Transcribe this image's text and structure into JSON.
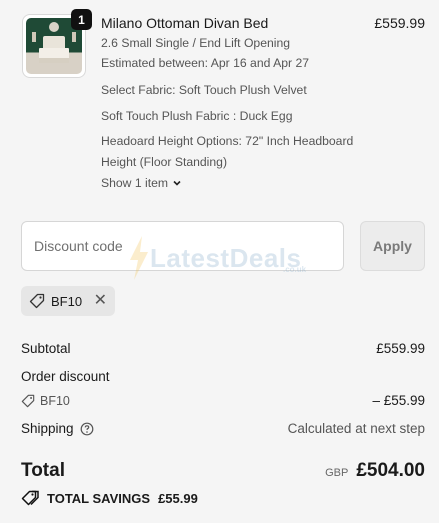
{
  "product": {
    "quantity": "1",
    "name": "Milano Ottoman Divan Bed",
    "price": "£559.99",
    "lines": [
      "2.6 Small Single / End Lift Opening",
      "Estimated between: Apr 16 and Apr 27",
      "Select Fabric: Soft Touch Plush Velvet",
      "Soft Touch Plush Fabric : Duck Egg",
      "Headoard Height Options: 72\" Inch Headboard",
      "Height (Floor Standing)"
    ],
    "show_items_label": "Show 1 item"
  },
  "discount": {
    "placeholder": "Discount code",
    "apply_label": "Apply",
    "applied_code": "BF10"
  },
  "watermark": {
    "text": "LatestDeals",
    "sub": ".co.uk"
  },
  "summary": {
    "subtotal_label": "Subtotal",
    "subtotal_value": "£559.99",
    "order_discount_label": "Order discount",
    "discount_code": "BF10",
    "discount_value": "– £55.99",
    "shipping_label": "Shipping",
    "shipping_value": "Calculated at next step",
    "total_label": "Total",
    "currency": "GBP",
    "total_value": "£504.00",
    "savings_label": "TOTAL SAVINGS",
    "savings_value": "£55.99"
  },
  "icons": {
    "tag": "tag-icon",
    "close": "close-icon",
    "help": "help-circle-icon",
    "chevron": "chevron-down-icon",
    "savings": "savings-tag-icon"
  },
  "colors": {
    "background": "#f5f5f5",
    "badge": "#111111",
    "apply_disabled": "#ececec"
  }
}
